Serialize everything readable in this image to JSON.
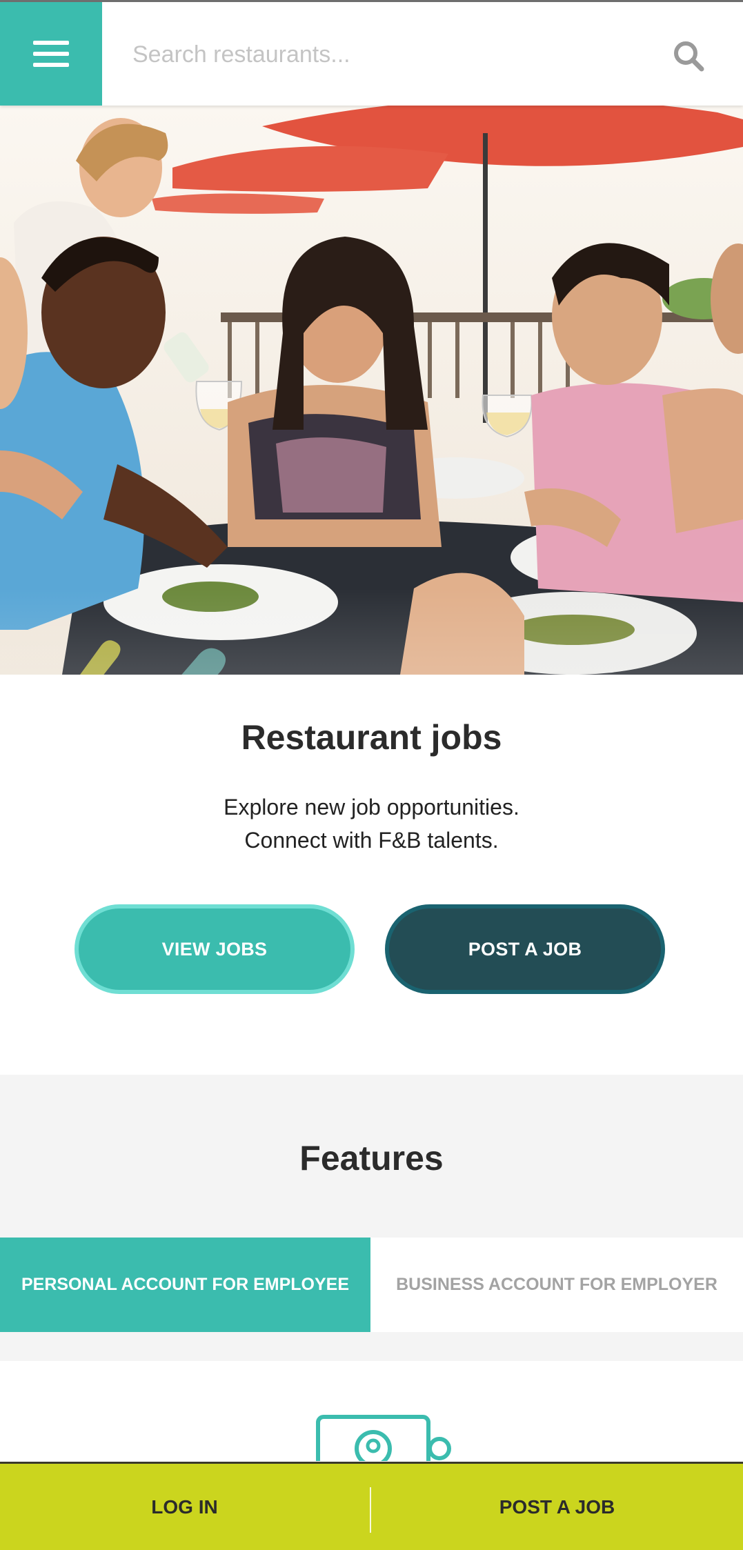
{
  "header": {
    "menu_icon": "hamburger-icon",
    "search_placeholder": "Search restaurants...",
    "search_icon": "search-icon"
  },
  "hero": {
    "image_subject": "group of friends dining outdoors under red umbrellas",
    "accent_colors": [
      "#e8e24a",
      "#7ee0d6"
    ]
  },
  "intro": {
    "title": "Restaurant jobs",
    "subtitle_line1": "Explore new job opportunities.",
    "subtitle_line2": "Connect with F&B talents.",
    "view_jobs_label": "VIEW JOBS",
    "post_job_label": "POST A JOB"
  },
  "features": {
    "title": "Features",
    "tabs": [
      {
        "label": "PERSONAL ACCOUNT FOR EMPLOYEE",
        "active": true
      },
      {
        "label": "BUSINESS ACCOUNT FOR EMPLOYER",
        "active": false
      }
    ],
    "icon": "cv-profile-icon"
  },
  "bottom_bar": {
    "login_label": "LOG IN",
    "post_job_label": "POST A JOB"
  },
  "colors": {
    "brand_teal": "#3bbcae",
    "dark_teal": "#234d55",
    "bottom_bar": "#cbd51e",
    "features_bg": "#f4f4f4",
    "inactive_tab_text": "#a3a3a3"
  }
}
